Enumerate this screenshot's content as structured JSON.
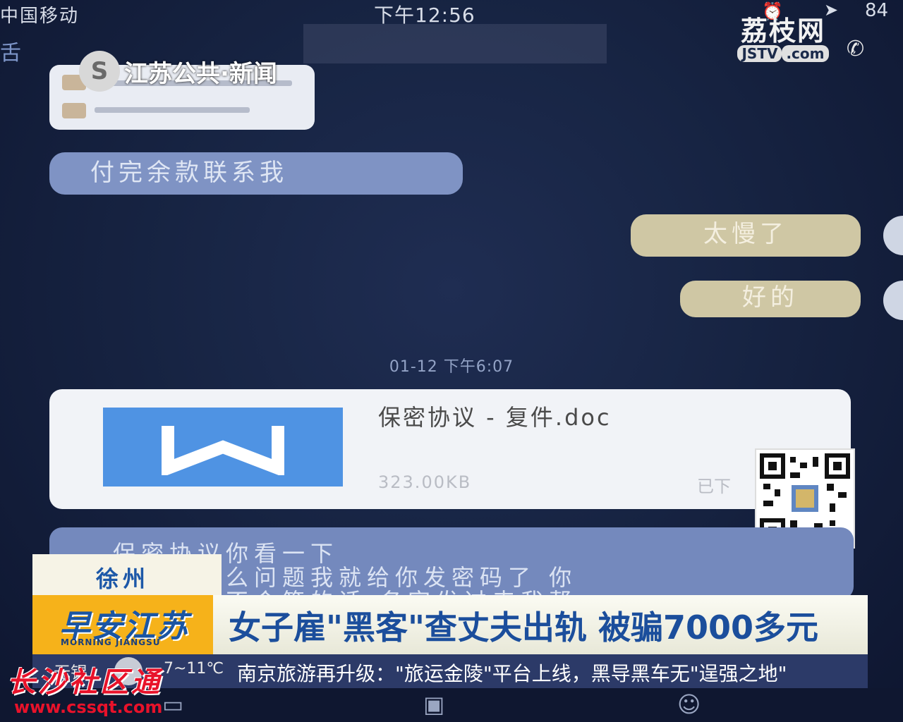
{
  "status_bar": {
    "carrier": "中国移动",
    "time": "下午12:56",
    "battery": "84"
  },
  "header": {
    "back_text": "舌"
  },
  "overlay": {
    "channel_name": "江苏公共·新闻",
    "lizhi_cn": "荔枝网",
    "lizhi_en": "JSTV",
    "lizhi_domain": ".com"
  },
  "chat": {
    "messages": [
      {
        "side": "left",
        "text": "付完余款联系我"
      },
      {
        "side": "right",
        "text": "太慢了"
      },
      {
        "side": "right",
        "text": "好的"
      }
    ],
    "timestamp": "01-12 下午6:07",
    "file": {
      "name": "保密协议 - 复件.doc",
      "size": "323.00KB",
      "status": "已下"
    },
    "text_lines": [
      "保密协议你看一下",
      "么问题我就给你发密码了 你",
      "不会签的话 名字发过来我帮"
    ]
  },
  "news": {
    "location": "徐州",
    "show_cn": "早安江苏",
    "show_en": "MORNING JIANGSU",
    "headline": "女子雇\"黑客\"查丈夫出轨 被骗7000多元",
    "weather_city": "无锡",
    "weather_temp": "7~11℃",
    "ticker": "南京旅游再升级：\"旅运金陵\"平台上线，黑导黑车无\"逞强之地\""
  },
  "watermark": {
    "cn": "长沙社区通",
    "url": "www.cssqt.com"
  },
  "colors": {
    "chat_background": "#172443",
    "left_bubble": "#7f93c4",
    "right_bubble": "#cfc7a4",
    "headline_blue": "#1b4e9c",
    "show_logo_bg": "#f6b21a",
    "word_icon_blue": "#4f93e3"
  }
}
